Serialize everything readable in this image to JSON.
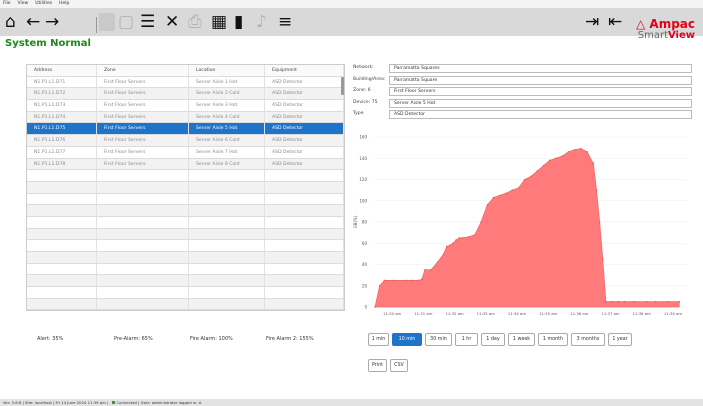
{
  "menu": [
    "File",
    "View",
    "Utilities",
    "Help"
  ],
  "toolbar": {
    "left": [
      {
        "icon": "home-icon",
        "glyph": "⌂",
        "enabled": true
      },
      {
        "icon": "back-arrow-icon",
        "glyph": "←",
        "enabled": true
      },
      {
        "icon": "forward-arrow-icon",
        "glyph": "→",
        "enabled": true
      }
    ],
    "middle": [
      {
        "icon": "calendar-disabled-icon",
        "glyph": "▢",
        "enabled": false
      },
      {
        "icon": "list-icon",
        "glyph": "☰",
        "enabled": true
      },
      {
        "icon": "mute-icon",
        "glyph": "✕",
        "enabled": true
      },
      {
        "icon": "printer-icon",
        "glyph": "⎙",
        "enabled": false
      },
      {
        "icon": "calendar-icon",
        "glyph": "▦",
        "enabled": true
      },
      {
        "icon": "bar-chart-icon",
        "glyph": "▮",
        "enabled": true
      },
      {
        "icon": "bell-icon",
        "glyph": "♪",
        "enabled": false
      },
      {
        "icon": "menu-icon",
        "glyph": "≡",
        "enabled": true
      }
    ],
    "right": [
      {
        "icon": "logout-icon",
        "glyph": "⇥",
        "enabled": true
      },
      {
        "icon": "login-icon",
        "glyph": "⇤",
        "enabled": true
      }
    ]
  },
  "logo": {
    "brand": "Ampac",
    "product_a": "Smart",
    "product_b": "View"
  },
  "status": "System Normal",
  "table": {
    "headers": [
      "Address",
      "Zone",
      "Location",
      "Equipment"
    ],
    "rows": [
      [
        "N1.P1.L1.D71",
        "First Floor Servers",
        "Server Aisle 1 Hot",
        "ASD Detector"
      ],
      [
        "N1.P1.L1.D72",
        "First Floor Servers",
        "Server Aisle 2 Cold",
        "ASD Detector"
      ],
      [
        "N1.P1.L1.D73",
        "First Floor Servers",
        "Server Aisle 3 Hot",
        "ASD Detector"
      ],
      [
        "N1.P1.L1.D74",
        "First Floor Servers",
        "Server Aisle 4 Cold",
        "ASD Detector"
      ],
      [
        "N1.P1.L1.D75",
        "First Floor Servers",
        "Server Aisle 5 Hot",
        "ASD Detector"
      ],
      [
        "N1.P1.L1.D76",
        "First Floor Servers",
        "Server Aisle 6 Cold",
        "ASD Detector"
      ],
      [
        "N1.P1.L1.D77",
        "First Floor Servers",
        "Server Aisle 7 Hot",
        "ASD Detector"
      ],
      [
        "N1.P1.L1.D78",
        "First Floor Servers",
        "Server Aisle 8 Cold",
        "ASD Detector"
      ]
    ],
    "selected_index": 4,
    "empty_rows": 12
  },
  "legend": {
    "alert": "Alert: 35%",
    "pre_alarm": "Pre-Alarm: 65%",
    "fire_alarm": "Fire Alarm: 100%",
    "fire_alarm_2": "Fire Alarm 2: 155%"
  },
  "details": [
    {
      "label": "Network:",
      "value": "Parramatta Squares"
    },
    {
      "label": "Building/Area:",
      "value": "Parramatta Square"
    },
    {
      "label": "Zone: 6",
      "value": "First Floor Servers"
    },
    {
      "label": "Device: 75",
      "value": "Server Aisle 5 Hot"
    },
    {
      "label": "Type",
      "value": "ASD Detector"
    }
  ],
  "chart_data": {
    "type": "area",
    "ylabel": "OB(%)",
    "ylim": [
      0,
      160
    ],
    "yticks": [
      0,
      20,
      40,
      60,
      80,
      100,
      120,
      140,
      160
    ],
    "xticks": [
      "11:30 am",
      "11:31 am",
      "11:32 am",
      "11:33 am",
      "11:34 am",
      "11:35 am",
      "11:36 am",
      "11:37 am",
      "11:38 am",
      "11:39 am"
    ],
    "color": "#ff7a7a",
    "x": [
      0,
      0.15,
      0.3,
      0.6,
      1.0,
      1.2,
      1.4,
      1.5,
      1.6,
      1.8,
      2.0,
      2.2,
      2.3,
      2.4,
      2.5,
      2.6,
      2.7,
      2.8,
      3.0,
      3.2,
      3.4,
      3.6,
      3.8,
      4.0,
      4.2,
      4.4,
      4.6,
      4.8,
      5.0,
      5.2,
      5.4,
      5.6,
      5.8,
      6.0,
      6.2,
      6.4,
      6.6,
      6.8,
      7.0,
      7.1,
      7.2,
      7.3,
      7.4,
      7.6,
      7.8,
      8.0,
      8.3,
      8.7,
      9.0,
      9.4,
      9.75
    ],
    "values": [
      0,
      20,
      25,
      25,
      25,
      25,
      25,
      26,
      35,
      35,
      42,
      50,
      57,
      58,
      60,
      63,
      65,
      65,
      66,
      68,
      80,
      96,
      103,
      105,
      107,
      110,
      112,
      120,
      123,
      128,
      133,
      138,
      140,
      142,
      146,
      148,
      149,
      146,
      135,
      110,
      80,
      45,
      5,
      5,
      5,
      5,
      5,
      5,
      5,
      5,
      5
    ]
  },
  "time_ranges": [
    "1 min",
    "10 min",
    "30 min",
    "1 hr",
    "1 day",
    "1 week",
    "1 month",
    "3 months",
    "1 year"
  ],
  "active_range": "10 min",
  "export": [
    "Print",
    "CSV"
  ],
  "footer": {
    "ver": "Ver: 3.8.6",
    "site": "Site: localhost",
    "date": "Fri 14 June 2024 11:39 am",
    "conn": "Connected",
    "user": "User: administrator",
    "level": "logged in: A"
  }
}
